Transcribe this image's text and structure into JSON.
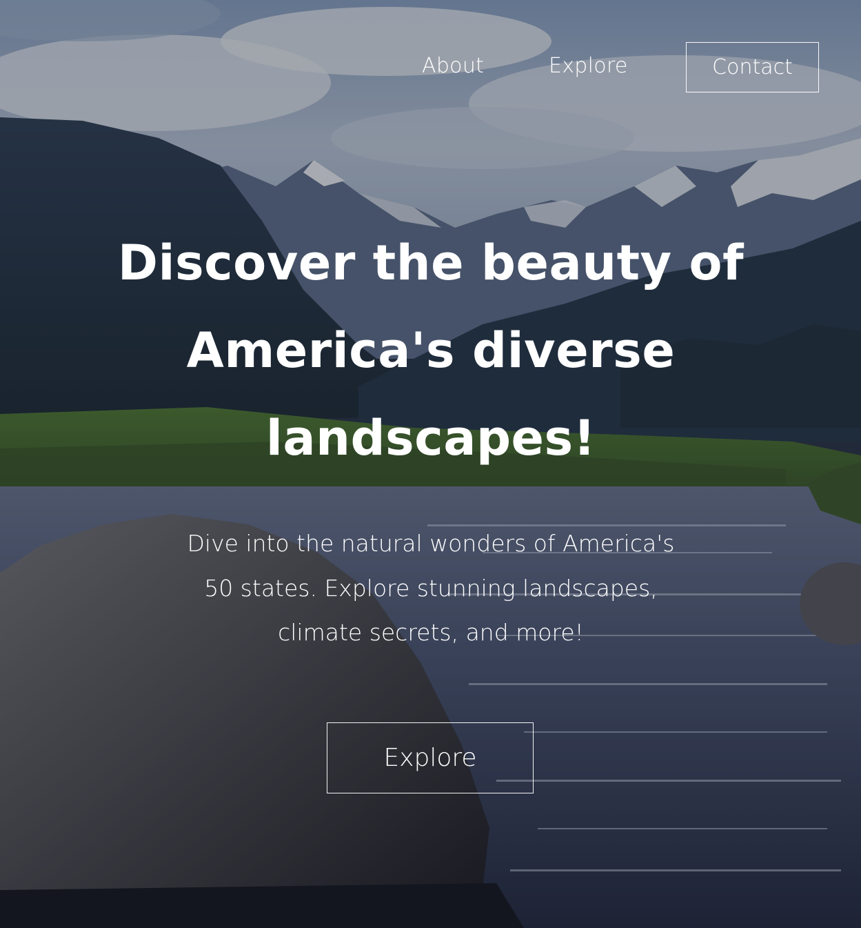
{
  "nav": {
    "about_label": "About",
    "explore_label": "Explore",
    "contact_label": "Contact"
  },
  "hero": {
    "title": "Discover the beauty of America's diverse landscapes!",
    "subtitle": "Dive into the natural wonders of America's 50 states. Explore stunning landscapes, climate secrets, and more!",
    "cta_label": "Explore"
  },
  "colors": {
    "text": "#ffffff",
    "overlay": "rgba(20, 22, 32, 0.32)",
    "border": "#ffffff"
  }
}
